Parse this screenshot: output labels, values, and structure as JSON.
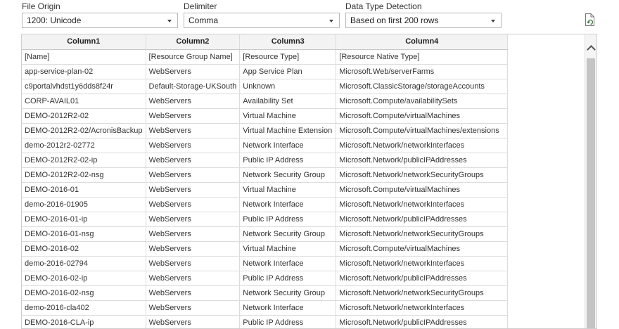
{
  "file_origin": {
    "label": "File Origin",
    "value": "1200: Unicode"
  },
  "delimiter": {
    "label": "Delimiter",
    "value": "Comma"
  },
  "type_detection": {
    "label": "Data Type Detection",
    "value": "Based on first 200 rows"
  },
  "icons": {
    "refresh": "refresh-file-icon",
    "scroll_up": "chevron-up-icon"
  },
  "table": {
    "headers": [
      "Column1",
      "Column2",
      "Column3",
      "Column4"
    ],
    "rows": [
      [
        "[Name]",
        "[Resource Group Name]",
        "[Resource Type]",
        "[Resource Native Type]"
      ],
      [
        "app-service-plan-02",
        "WebServers",
        "App Service Plan",
        "Microsoft.Web/serverFarms"
      ],
      [
        "c9portalvhdst1y6dds8f24r",
        "Default-Storage-UKSouth",
        "Unknown",
        "Microsoft.ClassicStorage/storageAccounts"
      ],
      [
        "CORP-AVAIL01",
        "WebServers",
        "Availability Set",
        "Microsoft.Compute/availabilitySets"
      ],
      [
        "DEMO-2012R2-02",
        "WebServers",
        "Virtual Machine",
        "Microsoft.Compute/virtualMachines"
      ],
      [
        "DEMO-2012R2-02/AcronisBackup",
        "WebServers",
        "Virtual Machine Extension",
        "Microsoft.Compute/virtualMachines/extensions"
      ],
      [
        "demo-2012r2-02772",
        "WebServers",
        "Network Interface",
        "Microsoft.Network/networkInterfaces"
      ],
      [
        "DEMO-2012R2-02-ip",
        "WebServers",
        "Public IP Address",
        "Microsoft.Network/publicIPAddresses"
      ],
      [
        "DEMO-2012R2-02-nsg",
        "WebServers",
        "Network Security Group",
        "Microsoft.Network/networkSecurityGroups"
      ],
      [
        "DEMO-2016-01",
        "WebServers",
        "Virtual Machine",
        "Microsoft.Compute/virtualMachines"
      ],
      [
        "demo-2016-01905",
        "WebServers",
        "Network Interface",
        "Microsoft.Network/networkInterfaces"
      ],
      [
        "DEMO-2016-01-ip",
        "WebServers",
        "Public IP Address",
        "Microsoft.Network/publicIPAddresses"
      ],
      [
        "DEMO-2016-01-nsg",
        "WebServers",
        "Network Security Group",
        "Microsoft.Network/networkSecurityGroups"
      ],
      [
        "DEMO-2016-02",
        "WebServers",
        "Virtual Machine",
        "Microsoft.Compute/virtualMachines"
      ],
      [
        "demo-2016-02794",
        "WebServers",
        "Network Interface",
        "Microsoft.Network/networkInterfaces"
      ],
      [
        "DEMO-2016-02-ip",
        "WebServers",
        "Public IP Address",
        "Microsoft.Network/publicIPAddresses"
      ],
      [
        "DEMO-2016-02-nsg",
        "WebServers",
        "Network Security Group",
        "Microsoft.Network/networkSecurityGroups"
      ],
      [
        "demo-2016-cla402",
        "WebServers",
        "Network Interface",
        "Microsoft.Network/networkInterfaces"
      ],
      [
        "DEMO-2016-CLA-ip",
        "WebServers",
        "Public IP Address",
        "Microsoft.Network/publicIPAddresses"
      ]
    ]
  }
}
